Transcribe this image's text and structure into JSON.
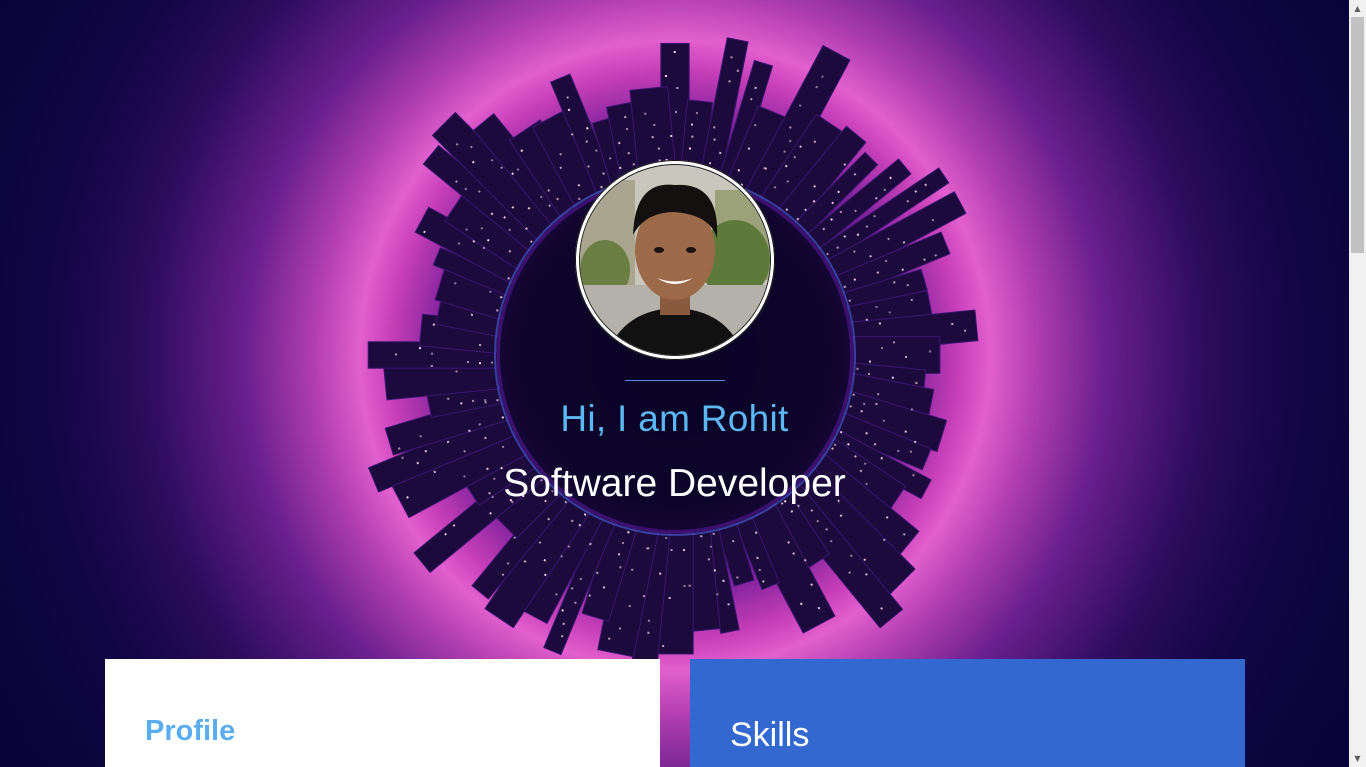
{
  "hero": {
    "greeting": "Hi, I am Rohit",
    "role": "Software Developer",
    "avatar_alt": "Rohit"
  },
  "cards": {
    "profile_title": "Profile",
    "skills_title": "Skills"
  },
  "scrollbar": {
    "up_arrow": "▲",
    "down_arrow": "▼"
  },
  "colors": {
    "greeting": "#5cb8f2",
    "skills_card": "#3268cf",
    "profile_title": "#5aaef0",
    "background": "#0a0535"
  }
}
